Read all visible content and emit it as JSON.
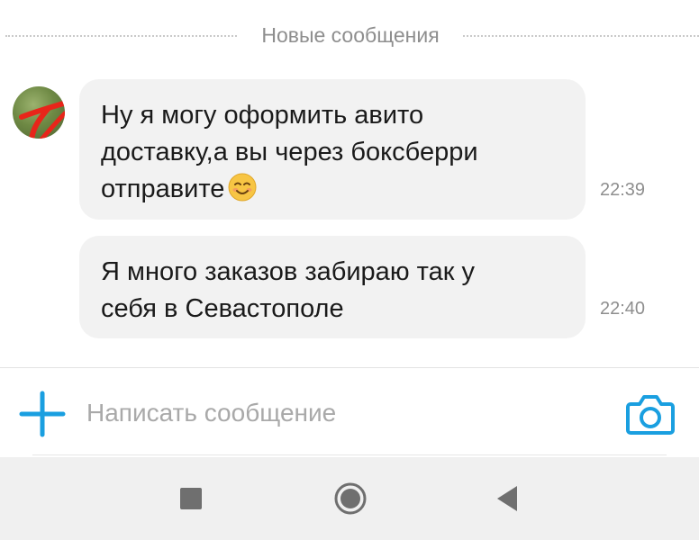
{
  "divider": {
    "label": "Новые сообщения"
  },
  "messages": [
    {
      "text": "Ну я могу оформить авито\nдоставку,а вы через боксберри\nотправите",
      "emoji": "smiling-face-icon",
      "time": "22:39"
    },
    {
      "text": "Я много заказов забираю так у\nсебя в Севастополе",
      "time": "22:40"
    }
  ],
  "composer": {
    "placeholder": "Написать сообщение",
    "value": ""
  },
  "icons": {
    "add": "plus-icon",
    "camera": "camera-icon",
    "nav_recents": "square-icon",
    "nav_home": "circle-icon",
    "nav_back": "triangle-back-icon"
  },
  "colors": {
    "accent": "#1a9fe0",
    "bubble": "#f2f2f2",
    "scribble": "#e8251a"
  }
}
